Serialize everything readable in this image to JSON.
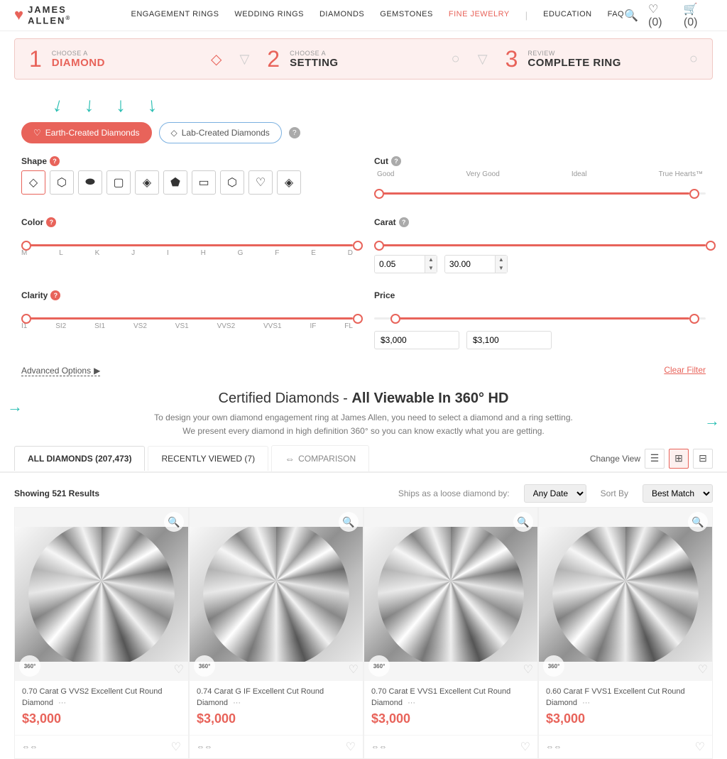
{
  "nav": {
    "logo_text": "JAMES ALLEN",
    "logo_reg": "®",
    "links": [
      {
        "label": "ENGAGEMENT RINGS",
        "active": false
      },
      {
        "label": "WEDDING RINGS",
        "active": false
      },
      {
        "label": "DIAMONDS",
        "active": false
      },
      {
        "label": "GEMSTONES",
        "active": false
      },
      {
        "label": "FINE JEWELRY",
        "active": true
      },
      {
        "label": "EDUCATION",
        "active": false
      },
      {
        "label": "FAQ",
        "active": false
      }
    ],
    "wishlist_count": "0",
    "cart_count": "0"
  },
  "steps": [
    {
      "num": "1",
      "sub": "CHOOSE A",
      "main": "DIAMOND",
      "active": true
    },
    {
      "num": "2",
      "sub": "CHOOSE A",
      "main": "SETTING",
      "active": false
    },
    {
      "num": "3",
      "sub": "REVIEW",
      "main": "COMPLETE RING",
      "active": false
    }
  ],
  "diamond_types": {
    "earth_label": "Earth-Created Diamonds",
    "lab_label": "Lab-Created Diamonds"
  },
  "filters": {
    "shape_label": "Shape",
    "cut_label": "Cut",
    "color_label": "Color",
    "carat_label": "Carat",
    "clarity_label": "Clarity",
    "price_label": "Price",
    "cut_labels": [
      "Good",
      "Very Good",
      "Ideal",
      "True Hearts™"
    ],
    "color_labels": [
      "M",
      "L",
      "K",
      "J",
      "I",
      "H",
      "G",
      "F",
      "E",
      "D"
    ],
    "clarity_labels": [
      "I1",
      "SI2",
      "SI1",
      "VS2",
      "VS1",
      "VVS2",
      "VVS1",
      "IF",
      "FL"
    ],
    "carat_min": "0.05",
    "carat_max": "30.00",
    "price_min": "$3,000",
    "price_max": "$3,100",
    "advanced_options": "Advanced Options",
    "clear_filter": "Clear Filter"
  },
  "main_section": {
    "heading": "Certified Diamonds - ",
    "heading_bold": "All Viewable In 360° HD",
    "subtext_line1": "To design your own diamond engagement ring at James Allen, you need to select a diamond and a ring setting.",
    "subtext_line2": "We present every diamond in high definition 360° so you can know exactly what you are getting."
  },
  "tabs": [
    {
      "label": "ALL DIAMONDS (207,473)",
      "active": true
    },
    {
      "label": "RECENTLY VIEWED (7)",
      "active": false
    },
    {
      "label": "COMPARISON",
      "active": false,
      "icon": "compare"
    }
  ],
  "results": {
    "showing": "Showing 521 Results",
    "ships_label": "Ships as a loose diamond by:",
    "ships_value": "Any Date",
    "sort_label": "Sort By",
    "sort_value": "Best Match"
  },
  "diamonds": [
    {
      "title": "0.70 Carat G VVS2 Excellent Cut Round Diamond",
      "price": "$3,000"
    },
    {
      "title": "0.74 Carat G IF Excellent Cut Round Diamond",
      "price": "$3,000"
    },
    {
      "title": "0.70 Carat E VVS1 Excellent Cut Round Diamond",
      "price": "$3,000"
    },
    {
      "title": "0.60 Carat F VVS1 Excellent Cut Round Diamond",
      "price": "$3,000"
    }
  ],
  "shapes": [
    {
      "name": "round",
      "symbol": "◇"
    },
    {
      "name": "cushion",
      "symbol": "⬡"
    },
    {
      "name": "oval",
      "symbol": "⬬"
    },
    {
      "name": "square",
      "symbol": "▢"
    },
    {
      "name": "marquise",
      "symbol": "◇"
    },
    {
      "name": "asscher",
      "symbol": "⬟"
    },
    {
      "name": "emerald",
      "symbol": "▭"
    },
    {
      "name": "radiant",
      "symbol": "◈"
    },
    {
      "name": "heart",
      "symbol": "♡"
    },
    {
      "name": "pear",
      "symbol": "⬡"
    }
  ]
}
